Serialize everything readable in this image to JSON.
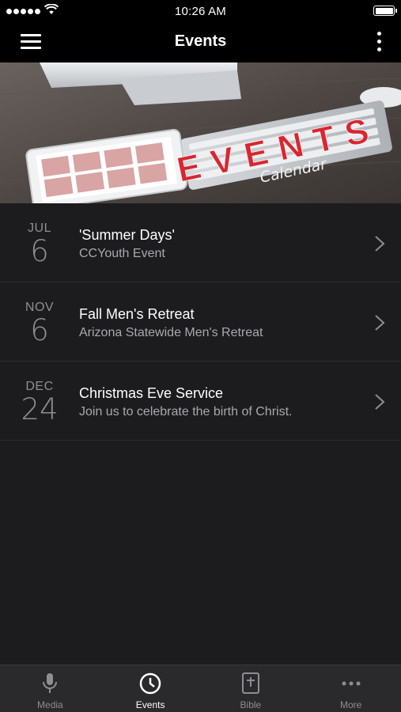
{
  "status_bar": {
    "time": "10:26 AM"
  },
  "nav": {
    "title": "Events",
    "left_icon": "hamburger-menu-icon",
    "right_icon": "kebab-menu-icon"
  },
  "banner": {
    "heading": "EVENTS",
    "subheading": "Calendar",
    "accent_color": "#d92630"
  },
  "events": [
    {
      "month": "JUL",
      "day": "6",
      "title": "'Summer Days'",
      "subtitle": "CCYouth Event"
    },
    {
      "month": "NOV",
      "day": "6",
      "title": "Fall Men's Retreat",
      "subtitle": "Arizona Statewide Men's Retreat"
    },
    {
      "month": "DEC",
      "day": "24",
      "title": "Christmas Eve Service",
      "subtitle": "Join us to celebrate the birth of Christ."
    }
  ],
  "tabs": [
    {
      "label": "Media",
      "icon": "microphone-icon",
      "active": false
    },
    {
      "label": "Events",
      "icon": "clock-icon",
      "active": true
    },
    {
      "label": "Bible",
      "icon": "bible-icon",
      "active": false
    },
    {
      "label": "More",
      "icon": "more-dots-icon",
      "active": false
    }
  ],
  "colors": {
    "background": "#1c1c1e",
    "bar": "#000000",
    "tab_bar": "#2a2a2c",
    "muted_text": "#8e8e93"
  }
}
